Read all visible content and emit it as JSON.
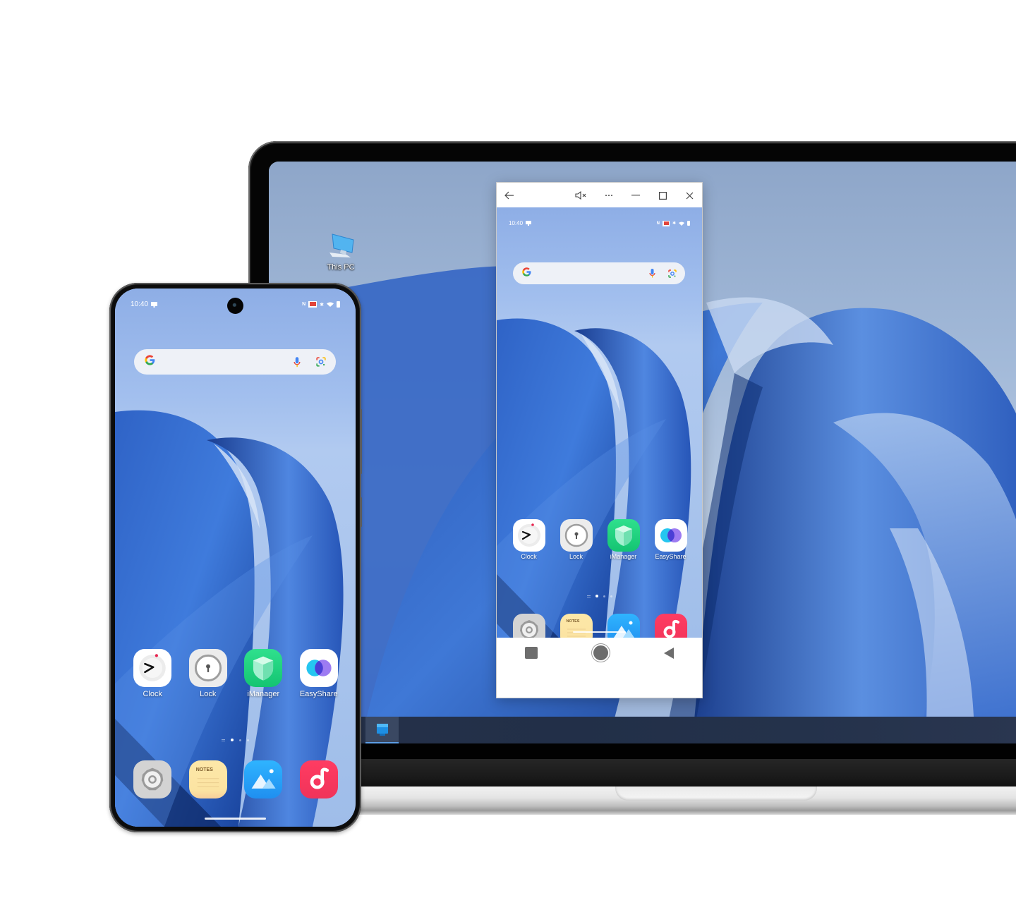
{
  "scene": {
    "description": "Phone screen mirrored to laptop desktop"
  },
  "desktop": {
    "icons": [
      {
        "label": "This PC",
        "icon": "computer-icon"
      }
    ],
    "taskbar": {
      "start_icon": "windows-start-icon"
    }
  },
  "mirror_window": {
    "titlebar": {
      "back_icon": "←",
      "mute_icon": "🔇",
      "more_icon": "···",
      "minimize_icon": "—",
      "maximize_icon": "☐",
      "close_icon": "✕"
    },
    "navbar": {
      "recent_icon": "square",
      "home_icon": "circle",
      "back_icon": "triangle-left"
    }
  },
  "android": {
    "status": {
      "time": "10:40",
      "left_icons": [
        "notification-icon"
      ],
      "right_icons": [
        "nfc-icon",
        "cast-icon",
        "bluetooth-icon",
        "wifi-icon",
        "battery-icon"
      ]
    },
    "search": {
      "logo": "G",
      "mic_icon": "mic-icon",
      "lens_icon": "lens-icon"
    },
    "apps_row1": [
      {
        "label": "Clock",
        "icon": "clock-icon"
      },
      {
        "label": "Lock",
        "icon": "lock-icon"
      },
      {
        "label": "iManager",
        "icon": "shield-icon"
      },
      {
        "label": "EasyShare",
        "icon": "easyshare-icon"
      }
    ],
    "dock": [
      {
        "label": "Settings",
        "icon": "settings-icon"
      },
      {
        "label": "Notes",
        "icon": "notes-icon",
        "icon_text": "NOTES"
      },
      {
        "label": "Gallery",
        "icon": "gallery-icon"
      },
      {
        "label": "Music",
        "icon": "music-icon"
      }
    ],
    "page_indicator": {
      "pages": 3,
      "active": 1
    }
  }
}
